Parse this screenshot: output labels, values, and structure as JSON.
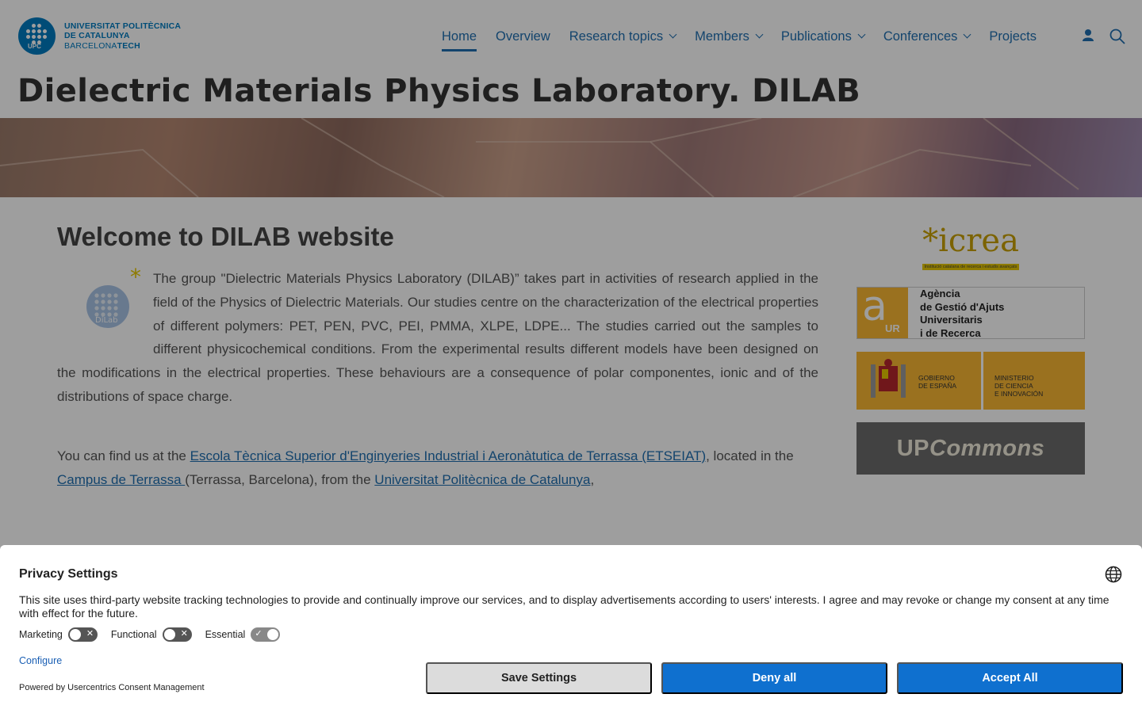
{
  "header": {
    "logo_lines": [
      "UNIVERSITAT POLITÈCNICA",
      "DE CATALUNYA",
      "BARCELONA",
      "TECH"
    ],
    "logo_abbr": "UPC",
    "nav": [
      {
        "label": "Home"
      },
      {
        "label": "Overview"
      },
      {
        "label": "Research topics"
      },
      {
        "label": "Members"
      },
      {
        "label": "Publications"
      },
      {
        "label": "Conferences"
      },
      {
        "label": "Projects"
      }
    ],
    "user_icon": "person-icon",
    "search_icon": "search-icon"
  },
  "page": {
    "title_main": "Dielectric Materials Physics Laboratory.",
    "title_bold": "DILAB"
  },
  "main": {
    "welcome": "Welcome to DILAB website",
    "intro": "The group \"Dielectric Materials Physics Laboratory (DILAB)” takes part in activities of research applied in the field of the Physics of Dielectric Materials. Our studies centre on the characterization of the electrical properties of different polymers: PET, PEN, PVC, PEI, PMMA, XLPE, LDPE... The studies carried out the samples to different physicochemical conditions. From the experimental results different models have been designed on the modifications in the electrical properties. These behaviours are a consequence of polar componentes, ionic and of the distributions of space charge.",
    "dilab_logo_text": "DiLab",
    "find_prefix": "You can find us at the ",
    "link_school": "Escola Tècnica Superior d'Enginyeries Industrial i Aeronàtutica de Terrassa (ETSEIAT)",
    "find_mid": ", located in the ",
    "link_campus": "Campus de Terrassa ",
    "find_mid2": "(Terrassa, Barcelona), from the ",
    "link_upc": "Universitat Politècnica de Catalunya",
    "find_end": ","
  },
  "sidebar": {
    "icrea": "*icrea",
    "icrea_sub": "Institució catalana de recerca i estudis avançats",
    "agaur_lines": [
      "Agència",
      "de Gestió d'Ajuts",
      "Universitaris",
      "i de Recerca"
    ],
    "agaur_abbr": "UR",
    "gob_left": [
      "GOBIERNO",
      "DE ESPAÑA"
    ],
    "gob_right": [
      "MINISTERIO",
      "DE CIENCIA",
      "E INNOVACIÓN"
    ],
    "upcommons_a": "UP",
    "upcommons_b": "Commons"
  },
  "consent": {
    "title": "Privacy Settings",
    "text": "This site uses third-party website tracking technologies to provide and continually improve our services, and to display advertisements according to users' interests. I agree and may revoke or change my consent at any time with effect for the future.",
    "toggles": [
      {
        "label": "Marketing",
        "state": "off"
      },
      {
        "label": "Functional",
        "state": "off"
      },
      {
        "label": "Essential",
        "state": "on"
      }
    ],
    "configure": "Configure",
    "powered": "Powered by Usercentrics Consent Management",
    "save": "Save Settings",
    "deny": "Deny all",
    "accept": "Accept All",
    "accent": "#0f70cf"
  }
}
